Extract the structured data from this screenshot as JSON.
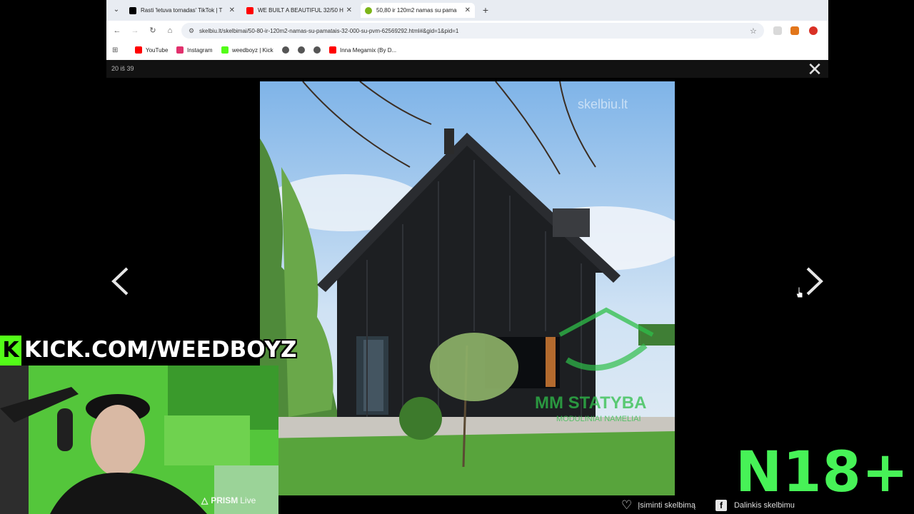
{
  "browser": {
    "tabs": [
      {
        "title": "Rasti 'letuva tornadas' TikTok | T",
        "favicon_color": "#000000"
      },
      {
        "title": "WE BUILT A BEAUTIFUL 32/50 H",
        "favicon_color": "#ff0000"
      },
      {
        "title": "50,80 ir 120m2 namas su pama",
        "favicon_color": "#7cb518"
      }
    ],
    "active_tab": 2,
    "url": "skelbiu.lt/skelbimai/50-80-ir-120m2-namas-su-pamatais-32-000-su-pvm-62569292.html#&gid=1&pid=1",
    "bookmarks": [
      {
        "label": "YouTube",
        "color": "#ff0000"
      },
      {
        "label": "Instagram",
        "color": "#e1306c"
      },
      {
        "label": "weedboyz | Kick",
        "color": "#53fc18"
      },
      {
        "label": "",
        "color": "#555555"
      },
      {
        "label": "",
        "color": "#555555"
      },
      {
        "label": "",
        "color": "#555555"
      },
      {
        "label": "Inna Megamix (By D...",
        "color": "#ff0000"
      }
    ]
  },
  "lightbox": {
    "counter": "20 iš 39",
    "close_symbol": "✕",
    "photo_watermark": "skelbiu.lt",
    "photo_brand": "MM STATYBA",
    "photo_brand_sub": "MODULINIAI NAMELIAI"
  },
  "overlay": {
    "kick_k": "K",
    "kick_url": "KICK.COM/WEEDBOYZ",
    "prism_brand": "PRISM",
    "prism_live": "Live",
    "age_badge": "N18+"
  },
  "actions": {
    "save": "Įsiminti skelbimą",
    "share": "Dalinkis skelbimu"
  },
  "colors": {
    "accent_green": "#47f257",
    "kick_green": "#53fc18"
  }
}
